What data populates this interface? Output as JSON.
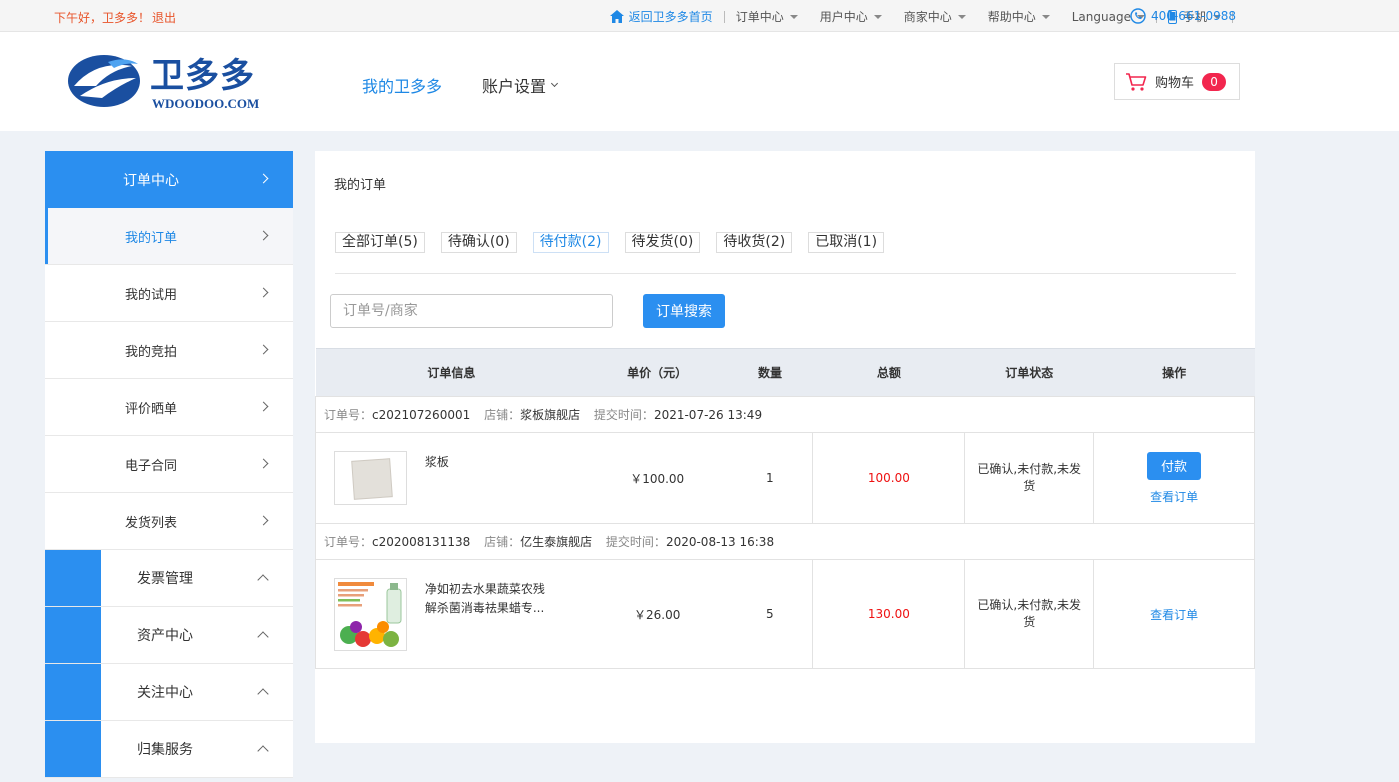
{
  "topbar": {
    "greeting": "下午好，卫多多！",
    "logout": "退出",
    "home_link": "返回卫多多首页",
    "nav": [
      {
        "label": "订单中心"
      },
      {
        "label": "用户中心"
      },
      {
        "label": "商家中心"
      },
      {
        "label": "帮助中心"
      },
      {
        "label": "Language"
      }
    ],
    "mobile": "手机",
    "phone": "400-661-0988"
  },
  "header": {
    "brand": "卫多多",
    "site": "WDOODOO.COM",
    "nav_my": "我的卫多多",
    "nav_account": "账户设置",
    "cart_label": "购物车",
    "cart_count": "0"
  },
  "sidebar": {
    "head": "订单中心",
    "items": [
      {
        "label": "我的订单"
      },
      {
        "label": "我的试用"
      },
      {
        "label": "我的竞拍"
      },
      {
        "label": "评价晒单"
      },
      {
        "label": "电子合同"
      },
      {
        "label": "发货列表"
      }
    ],
    "groups": [
      {
        "label": "发票管理"
      },
      {
        "label": "资产中心"
      },
      {
        "label": "关注中心"
      },
      {
        "label": "归集服务"
      }
    ]
  },
  "main": {
    "title": "我的订单",
    "tabs": [
      {
        "label": "全部订单(5)"
      },
      {
        "label": "待确认(0)"
      },
      {
        "label": "待付款(2)"
      },
      {
        "label": "待发货(0)"
      },
      {
        "label": "待收货(2)"
      },
      {
        "label": "已取消(1)"
      }
    ],
    "search_placeholder": "订单号/商家",
    "search_button": "订单搜索",
    "columns": [
      "订单信息",
      "单价（元）",
      "数量",
      "总额",
      "订单状态",
      "操作"
    ],
    "meta_labels": {
      "order_no": "订单号：",
      "shop": "店铺：",
      "time": "提交时间："
    },
    "orders": [
      {
        "order_no": "c202107260001",
        "shop": "浆板旗舰店",
        "time": "2021-07-26 13:49",
        "product": "浆板",
        "price": "￥100.00",
        "qty": "1",
        "total": "100.00",
        "status": "已确认,未付款,未发货",
        "pay": "付款",
        "view": "查看订单"
      },
      {
        "order_no": "c202008131138",
        "shop": "亿生泰旗舰店",
        "time": "2020-08-13 16:38",
        "product": "净如初去水果蔬菜农残解杀菌消毒祛果蜡专...",
        "price": "￥26.00",
        "qty": "5",
        "total": "130.00",
        "status": "已确认,未付款,未发货",
        "view": "查看订单"
      }
    ]
  },
  "colors": {
    "accent": "#2b8ff0",
    "link": "#1e88e5",
    "price": "#e11111",
    "greeting": "#e8542a"
  }
}
